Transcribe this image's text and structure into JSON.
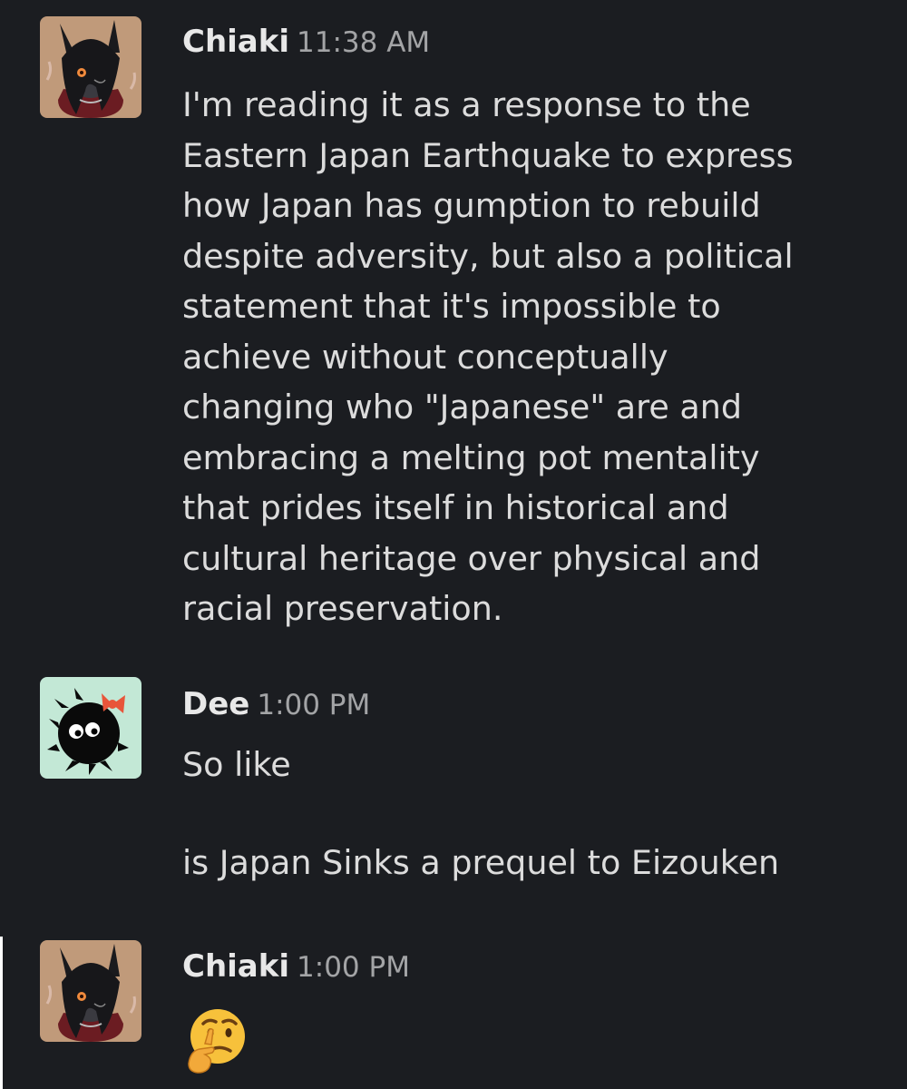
{
  "messages": [
    {
      "sender": "Chiaki",
      "time": "11:38 AM",
      "avatar": "anime-character-avatar",
      "lines": [
        "I'm reading it as a response to the",
        "Eastern Japan Earthquake to express",
        "how Japan has gumption to rebuild",
        "despite adversity, but also a political",
        "statement that it's impossible to",
        "achieve without conceptually",
        "changing who \"Japanese\" are and",
        "embracing a melting pot mentality",
        "that prides itself in historical and",
        "cultural heritage over physical and",
        "racial preservation."
      ]
    },
    {
      "sender": "Dee",
      "time": "1:00 PM",
      "avatar": "soot-sprite-avatar",
      "lines": [
        "So like",
        "is Japan Sinks a prequel to Eizouken"
      ]
    },
    {
      "sender": "Chiaki",
      "time": "1:00 PM",
      "avatar": "anime-character-avatar",
      "emoji": "thinking-face-emoji"
    }
  ],
  "colors": {
    "background": "#1b1d21",
    "text": "#dcdcdc",
    "timestamp": "#a3a4a6",
    "dee_avatar_bg": "#c3e8d6",
    "chiaki_avatar_bg": "#c09a7a"
  }
}
